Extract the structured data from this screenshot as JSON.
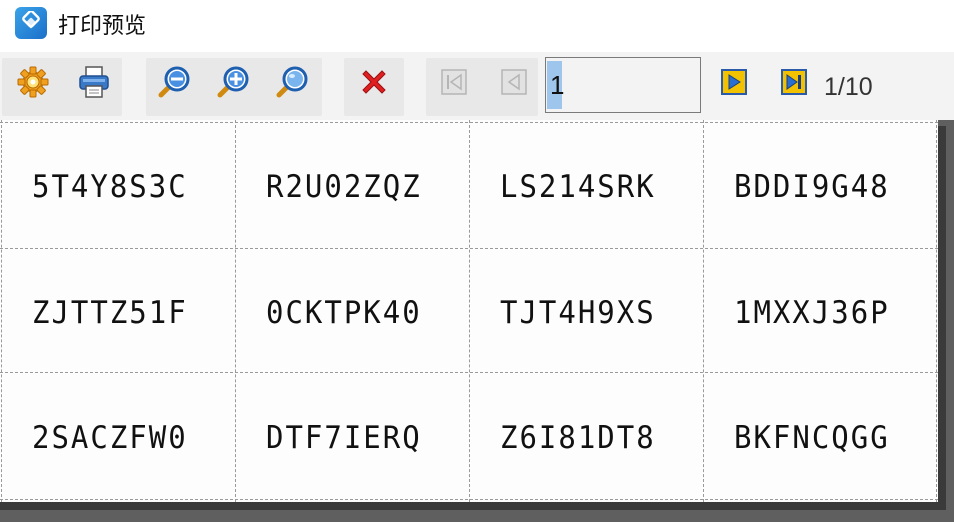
{
  "window": {
    "title": "打印预览"
  },
  "toolbar": {
    "buttons": [
      {
        "name": "settings",
        "icon": "gear-icon"
      },
      {
        "name": "print",
        "icon": "printer-icon"
      },
      {
        "name": "zoom-out",
        "icon": "zoom-out-icon"
      },
      {
        "name": "zoom-in",
        "icon": "zoom-in-icon"
      },
      {
        "name": "zoom-fit",
        "icon": "zoom-fit-icon"
      },
      {
        "name": "close",
        "icon": "close-icon"
      },
      {
        "name": "first-page",
        "icon": "first-page-icon",
        "enabled": false
      },
      {
        "name": "previous-page",
        "icon": "previous-page-icon",
        "enabled": false
      },
      {
        "name": "next-page",
        "icon": "next-page-icon",
        "enabled": true
      },
      {
        "name": "last-page",
        "icon": "last-page-icon",
        "enabled": true
      }
    ],
    "page_input_value": "1",
    "page_count": "1/10"
  },
  "labels": {
    "rows": [
      [
        "5T4Y8S3C",
        "R2U02ZQZ",
        "LS214SRK",
        "BDDI9G48"
      ],
      [
        "ZJTTZ51F",
        "0CKTPK40",
        "TJT4H9XS",
        "1MXXJ36P"
      ],
      [
        "2SACZFW0",
        "DTF7IERQ",
        "Z6I81DT8",
        "BKFNCQGG"
      ]
    ]
  },
  "colors": {
    "preview_background": "#5f5f5f",
    "paper": "#fdfdfd",
    "nav_enabled": "#f2c200",
    "close_red": "#e02020"
  }
}
